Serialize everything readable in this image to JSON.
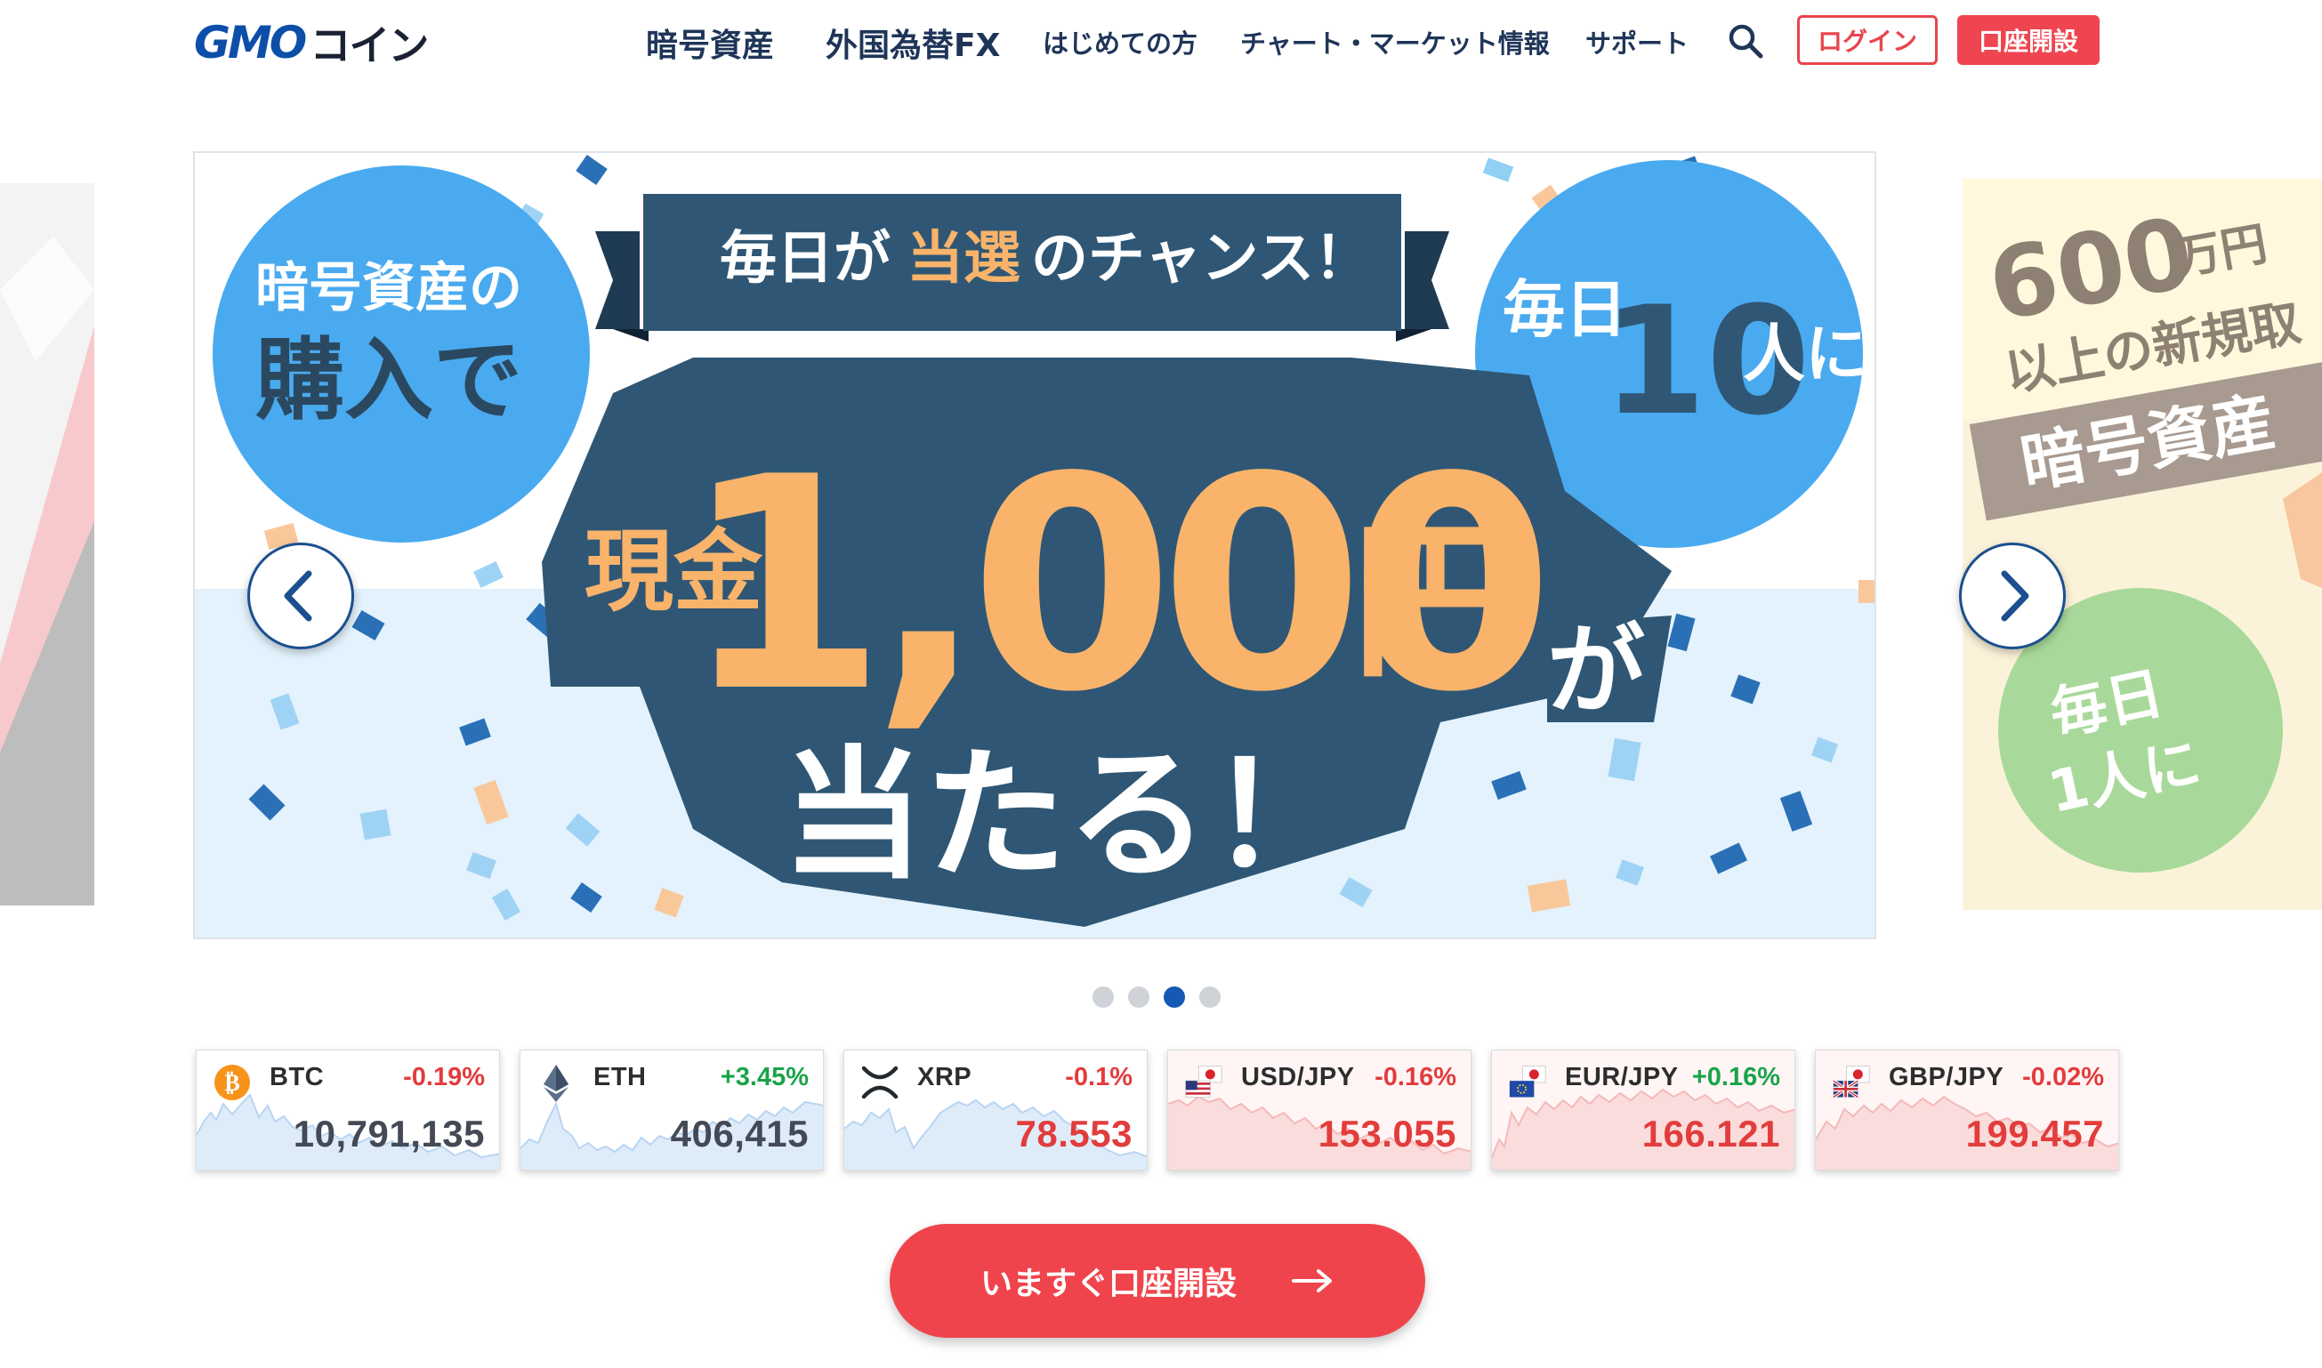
{
  "header": {
    "logo_gmo": "GMO",
    "logo_coin": "コイン",
    "nav": [
      "暗号資産",
      "外国為替FX",
      "はじめての方",
      "チャート・マーケット情報",
      "サポート"
    ],
    "login_label": "ログイン",
    "open_account_label": "口座開設"
  },
  "banner": {
    "circle_left_line1": "暗号資産の",
    "circle_left_line2": "購入で",
    "ribbon_text_a": "毎日が",
    "ribbon_text_b": "当選",
    "ribbon_text_c": "のチャンス！",
    "circle_right_a": "毎日",
    "circle_right_b": "10",
    "circle_right_c": "人に",
    "cash_label": "現金",
    "amount": "1,000",
    "yen": "円",
    "ga": "が",
    "bottom_text": "当たる！"
  },
  "next_banner": {
    "amount_text": "600",
    "man_yen": "万円",
    "line2": "以上の新規取",
    "line3": "暗号資産",
    "circle_a": "毎日",
    "circle_b": "1人に"
  },
  "carousel": {
    "slide_count": 4,
    "active_index": 2
  },
  "tickers": [
    {
      "symbol": "BTC",
      "change": "-0.19%",
      "price": "10,791,135",
      "change_sign": "neg",
      "price_color": "dark",
      "icon": "bitcoin-icon",
      "type": "crypto"
    },
    {
      "symbol": "ETH",
      "change": "+3.45%",
      "price": "406,415",
      "change_sign": "pos",
      "price_color": "dark",
      "icon": "ethereum-icon",
      "type": "crypto"
    },
    {
      "symbol": "XRP",
      "change": "-0.1%",
      "price": "78.553",
      "change_sign": "neg",
      "price_color": "neg",
      "icon": "xrp-icon",
      "type": "crypto"
    },
    {
      "symbol": "USD/JPY",
      "change": "-0.16%",
      "price": "153.055",
      "change_sign": "neg",
      "price_color": "neg",
      "icon": "us-jp-flag-icon",
      "type": "fx"
    },
    {
      "symbol": "EUR/JPY",
      "change": "+0.16%",
      "price": "166.121",
      "change_sign": "pos",
      "price_color": "neg",
      "icon": "eu-jp-flag-icon",
      "type": "fx"
    },
    {
      "symbol": "GBP/JPY",
      "change": "-0.02%",
      "price": "199.457",
      "change_sign": "neg",
      "price_color": "neg",
      "icon": "gb-jp-flag-icon",
      "type": "fx"
    }
  ],
  "cta_label": "いますぐ口座開設",
  "colors": {
    "brand_red": "#ee4550",
    "brand_blue": "#1559b5",
    "banner_navy": "#2f5775",
    "banner_orange": "#f9b36a",
    "banner_sky": "#4aa9ee"
  }
}
